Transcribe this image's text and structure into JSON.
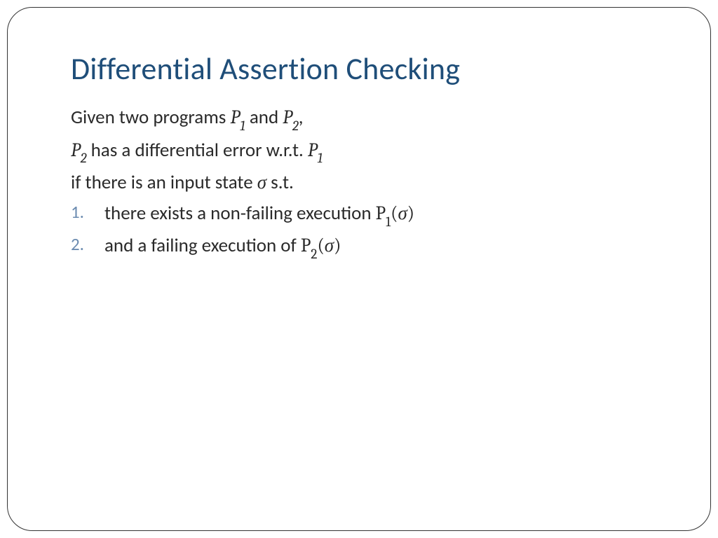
{
  "title": "Differential Assertion Checking",
  "line1_pre": "Given two programs ",
  "line1_mid": " and ",
  "line1_post": ",",
  "line2_mid": " has a differential error w.r.t. ",
  "line3_pre": "if there is an input state ",
  "line3_post": " s.t.",
  "item1_pre": "there exists a non-failing execution ",
  "item2_pre": "and a failing execution of ",
  "sym": {
    "P": "P",
    "one": "1",
    "two": "2",
    "sigma": "σ",
    "lparen": "(",
    "rparen": ")"
  }
}
